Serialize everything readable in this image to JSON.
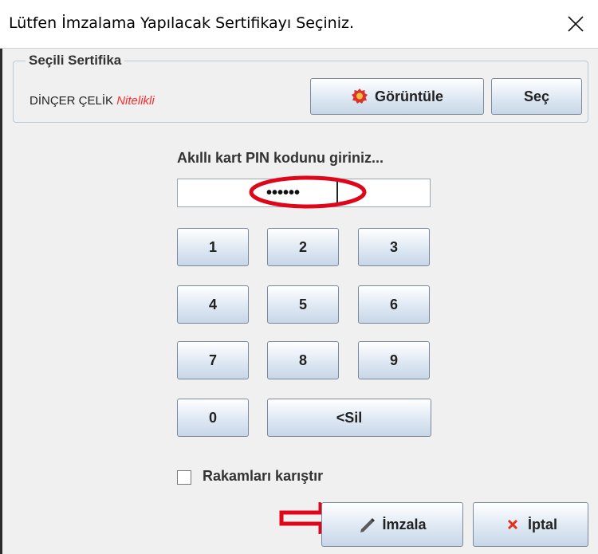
{
  "window": {
    "title": "Lütfen İmzalama Yapılacak Sertifikayı Seçiniz."
  },
  "certificate": {
    "group_title": "Seçili Sertifika",
    "holder": "DİNÇER ÇELİK",
    "qualifier": "Nitelikli",
    "view_label": "Görüntüle",
    "select_label": "Seç"
  },
  "pin": {
    "label": "Akıllı kart PIN kodunu giriniz...",
    "masked_value": "••••••"
  },
  "keypad": {
    "keys": [
      "1",
      "2",
      "3",
      "4",
      "5",
      "6",
      "7",
      "8",
      "9",
      "0"
    ],
    "delete_label": "<Sil"
  },
  "options": {
    "shuffle_label": "Rakamları karıştır",
    "shuffle_checked": false
  },
  "actions": {
    "sign_label": "İmzala",
    "cancel_label": "İptal"
  },
  "colors": {
    "qualifier": "#ff2a2a",
    "annotation": "#e0061a",
    "cancel_icon": "#e0301e"
  }
}
